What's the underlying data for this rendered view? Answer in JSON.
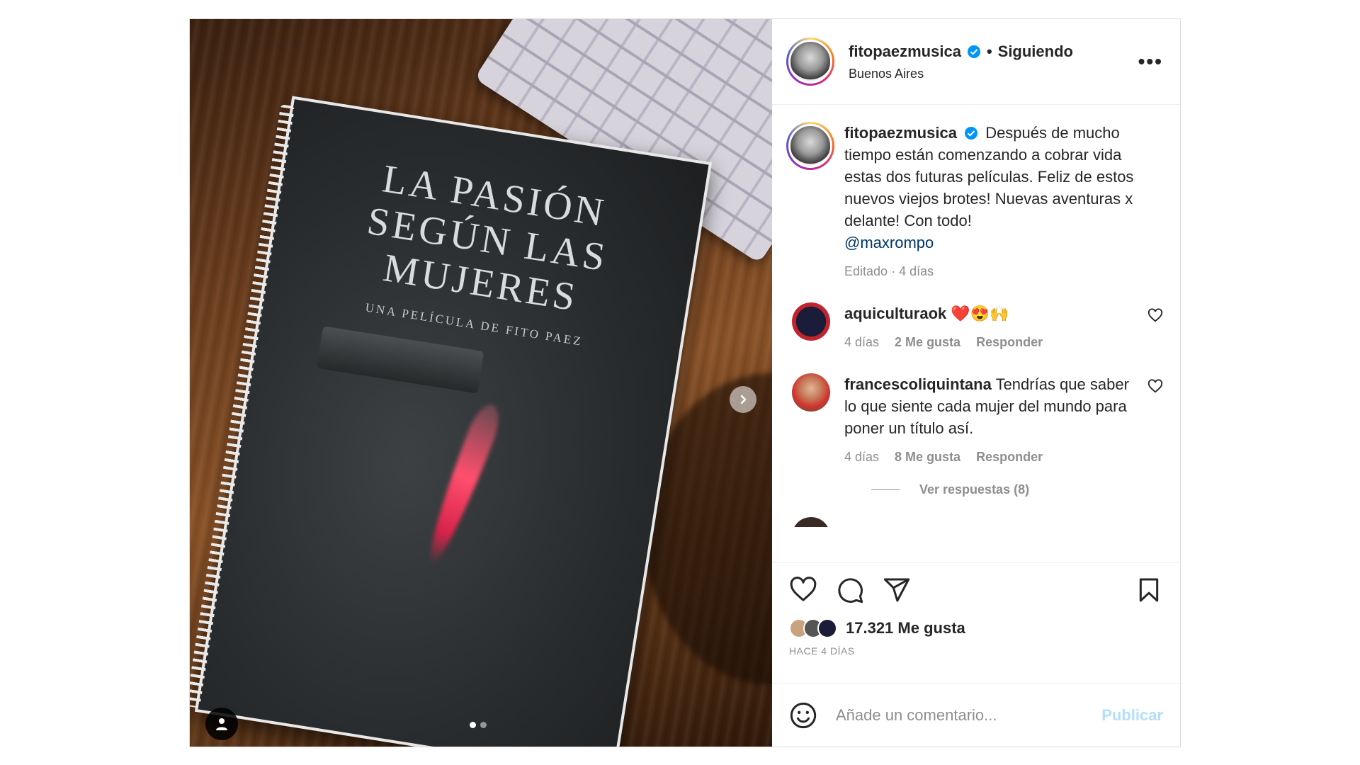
{
  "media": {
    "book_title": "LA PASIÓN SEGÚN LAS MUJERES",
    "book_subtitle": "UNA PELÍCULA DE FITO PAEZ",
    "carousel_total": 2,
    "carousel_current": 1
  },
  "header": {
    "username": "fitopaezmusica",
    "separator": "•",
    "follow_status": "Siguiendo",
    "location": "Buenos Aires",
    "more_icon": "•••"
  },
  "caption": {
    "username": "fitopaezmusica",
    "text": "Después de mucho tiempo están comenzando a cobrar vida estas dos futuras películas. Feliz de estos nuevos viejos brotes! Nuevas aventuras x delante! Con todo!",
    "mention": "@maxrompo",
    "edited": "Editado",
    "time": "4 días"
  },
  "comments": [
    {
      "username": "aquiculturaok",
      "text": "❤️😍🙌",
      "time": "4 días",
      "likes": "2 Me gusta",
      "reply": "Responder"
    },
    {
      "username": "francescoliquintana",
      "text": "Tendrías que saber lo que siente cada mujer del mundo para poner un título así.",
      "time": "4 días",
      "likes": "8 Me gusta",
      "reply": "Responder"
    }
  ],
  "view_replies": "Ver respuestas (8)",
  "stats": {
    "likes": "17.321 Me gusta",
    "posted": "HACE 4 DÍAS"
  },
  "composer": {
    "placeholder": "Añade un comentario...",
    "publish": "Publicar"
  },
  "colors": {
    "verified": "#0095f6",
    "link": "#00376b",
    "muted": "#8e8e8e",
    "publish_disabled": "#b2dffc"
  }
}
